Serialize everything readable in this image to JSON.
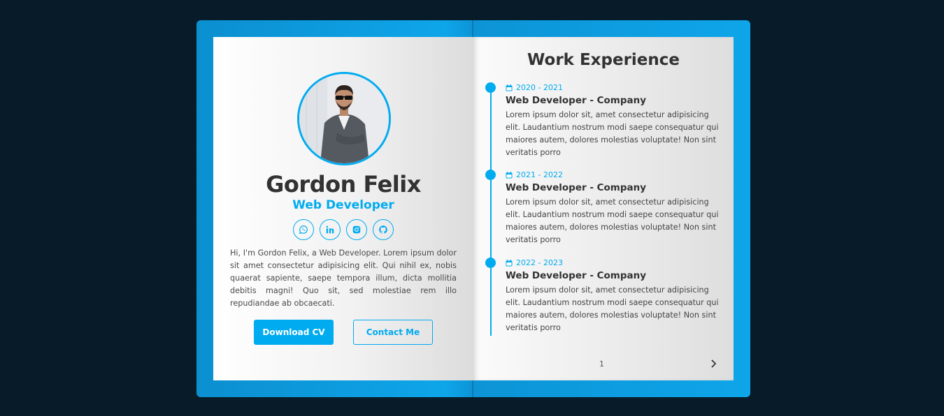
{
  "profile": {
    "name": "Gordon Felix",
    "role": "Web Developer",
    "bio": "Hi, I'm Gordon Felix, a Web Developer. Lorem ipsum dolor sit amet consectetur adipisicing elit. Qui nihil ex, nobis quaerat sapiente, saepe tempora illum, dicta mollitia debitis magni! Quo sit, sed molestiae rem illo repudiandae ab obcaecati.",
    "socials": [
      {
        "icon": "whatsapp-icon"
      },
      {
        "icon": "linkedin-icon"
      },
      {
        "icon": "instagram-icon"
      },
      {
        "icon": "github-icon"
      }
    ],
    "download_label": "Download CV",
    "contact_label": "Contact Me"
  },
  "experience": {
    "title": "Work Experience",
    "items": [
      {
        "date": "2020 - 2021",
        "job": "Web Developer - Company",
        "desc": "Lorem ipsum dolor sit, amet consectetur adipisicing elit. Laudantium nostrum modi saepe consequatur qui maiores autem, dolores molestias voluptate! Non sint veritatis porro"
      },
      {
        "date": "2021 - 2022",
        "job": "Web Developer - Company",
        "desc": "Lorem ipsum dolor sit, amet consectetur adipisicing elit. Laudantium nostrum modi saepe consequatur qui maiores autem, dolores molestias voluptate! Non sint veritatis porro"
      },
      {
        "date": "2022 - 2023",
        "job": "Web Developer - Company",
        "desc": "Lorem ipsum dolor sit, amet consectetur adipisicing elit. Laudantium nostrum modi saepe consequatur qui maiores autem, dolores molestias voluptate! Non sint veritatis porro"
      }
    ],
    "page_number": "1"
  },
  "colors": {
    "accent": "#00abf0",
    "background": "#081b29",
    "text": "#323232"
  }
}
